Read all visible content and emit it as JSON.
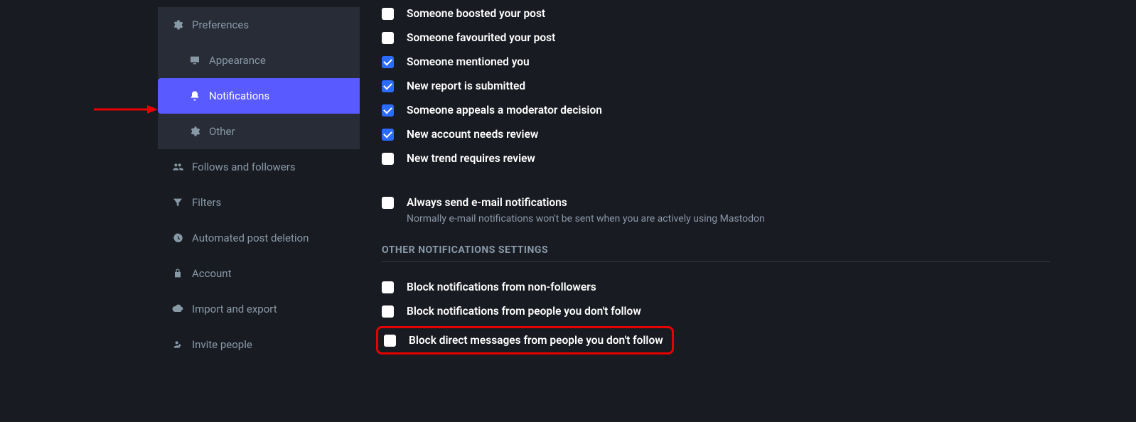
{
  "sidebar": {
    "items": [
      {
        "label": "Preferences",
        "icon": "gear"
      },
      {
        "label": "Appearance",
        "icon": "monitor"
      },
      {
        "label": "Notifications",
        "icon": "bell"
      },
      {
        "label": "Other",
        "icon": "gear"
      },
      {
        "label": "Follows and followers",
        "icon": "users"
      },
      {
        "label": "Filters",
        "icon": "filter"
      },
      {
        "label": "Automated post deletion",
        "icon": "history"
      },
      {
        "label": "Account",
        "icon": "lock"
      },
      {
        "label": "Import and export",
        "icon": "cloud"
      },
      {
        "label": "Invite people",
        "icon": "user-plus"
      }
    ]
  },
  "notifications": {
    "checks": [
      {
        "label": "Someone boosted your post",
        "checked": false
      },
      {
        "label": "Someone favourited your post",
        "checked": false
      },
      {
        "label": "Someone mentioned you",
        "checked": true
      },
      {
        "label": "New report is submitted",
        "checked": true
      },
      {
        "label": "Someone appeals a moderator decision",
        "checked": true
      },
      {
        "label": "New account needs review",
        "checked": true
      },
      {
        "label": "New trend requires review",
        "checked": false
      }
    ],
    "always_send": {
      "label": "Always send e-mail notifications",
      "hint": "Normally e-mail notifications won't be sent when you are actively using Mastodon",
      "checked": false
    },
    "other_header": "OTHER NOTIFICATIONS SETTINGS",
    "other_checks": [
      {
        "label": "Block notifications from non-followers",
        "checked": false
      },
      {
        "label": "Block notifications from people you don't follow",
        "checked": false
      },
      {
        "label": "Block direct messages from people you don't follow",
        "checked": false
      }
    ]
  }
}
